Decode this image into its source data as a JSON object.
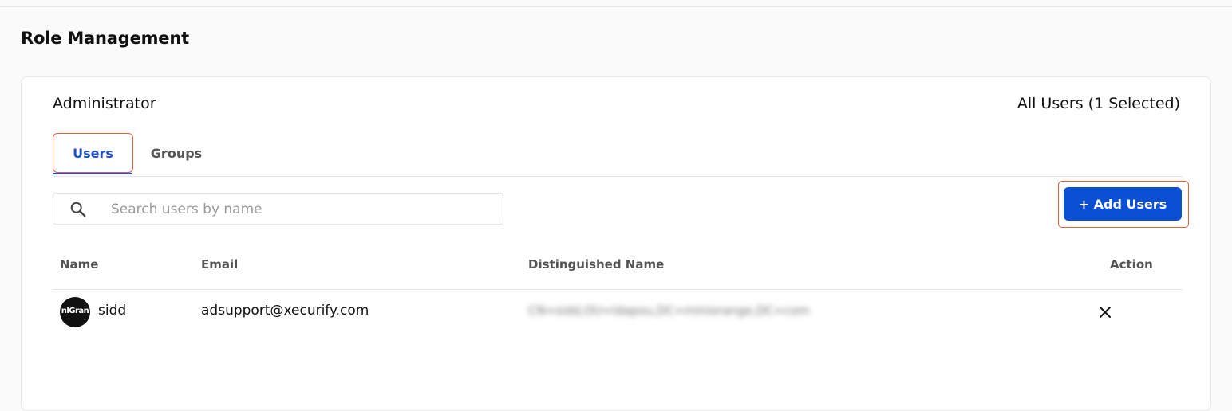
{
  "page": {
    "title": "Role Management"
  },
  "role": {
    "name": "Administrator",
    "selection_summary": "All Users (1 Selected)"
  },
  "tabs": [
    {
      "label": "Users",
      "active": true
    },
    {
      "label": "Groups",
      "active": false
    }
  ],
  "search": {
    "placeholder": "Search users by name",
    "value": ""
  },
  "toolbar": {
    "add_users_label": "+ Add Users"
  },
  "table": {
    "headers": {
      "name": "Name",
      "email": "Email",
      "dn": "Distinguished Name",
      "action": "Action"
    },
    "rows": [
      {
        "avatar_text": "nlGran",
        "name": "sidd",
        "email": "adsupport@xecurify.com",
        "dn": "CN=sidd,OU=ldapou,DC=miniorange,DC=com",
        "action_icon": "close-icon"
      }
    ]
  },
  "colors": {
    "accent": "#0b4fd4",
    "active_tab_text": "#1f4fc6",
    "highlight_border": "#e0603a"
  }
}
